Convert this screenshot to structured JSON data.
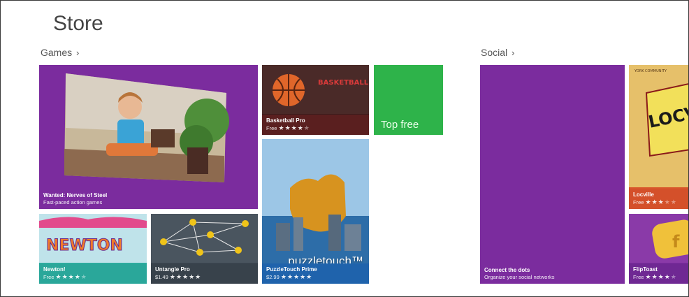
{
  "app": {
    "title": "Store"
  },
  "colors": {
    "purple": "#7b2c9e",
    "green": "#2eb34a",
    "teal": "#30b3a6",
    "slate": "#3d4751",
    "maroon": "#5a1f1f",
    "blue": "#1f6fbf",
    "orange": "#d8552a"
  },
  "groups": [
    {
      "label": "Games",
      "chevron": "›"
    },
    {
      "label": "Social",
      "chevron": "›"
    }
  ],
  "tiles": {
    "nerves": {
      "name": "Wanted: Nerves of Steel",
      "sub": "Fast-paced action games"
    },
    "basketball": {
      "name": "Basketball Pro",
      "price": "Free",
      "rating": 4,
      "art_text": "BASKETBALL PRO"
    },
    "topfree": {
      "label": "Top free"
    },
    "puzzle": {
      "name": "PuzzleTouch Prime",
      "price": "$2.99",
      "rating": 5,
      "art_text": "puzzletouch™"
    },
    "newton": {
      "name": "Newton!",
      "price": "Free",
      "rating": 4,
      "art_text": "NEWTON"
    },
    "untangle": {
      "name": "Untangle Pro",
      "price": "$1.49",
      "rating": 5
    },
    "connect": {
      "name": "Connect the dots",
      "sub": "Organize your social networks"
    },
    "locville": {
      "name": "Locville",
      "price": "Free",
      "rating": 3,
      "art_text": "LOCVILL",
      "art_top": "YORK COMMUNITY"
    },
    "fliptoast": {
      "name": "FlipToast",
      "price": "Free",
      "rating": 4,
      "art_text": "f"
    }
  }
}
